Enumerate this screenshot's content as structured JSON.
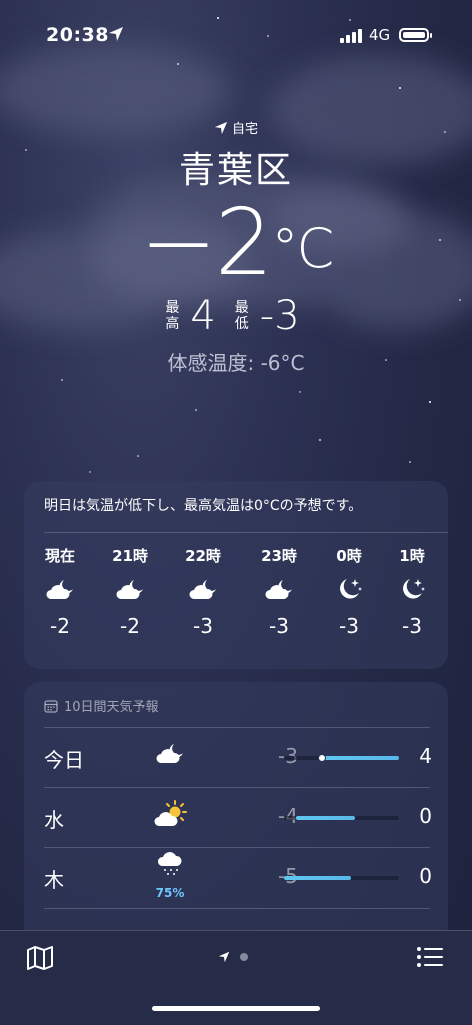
{
  "status": {
    "time": "20:38",
    "network": "4G"
  },
  "header": {
    "my_location_label": "自宅",
    "city": "青葉区",
    "temperature": "−2",
    "unit": "°C",
    "hi_label_1": "最",
    "hi_label_2": "高",
    "hi_value": "4",
    "lo_label_1": "最",
    "lo_label_2": "低",
    "lo_value": "-3",
    "feels_like": "体感温度: -6°C"
  },
  "hourly": {
    "summary": "明日は気温が低下し、最高気温は0°Cの予想です。",
    "items": [
      {
        "label": "現在",
        "temp": "-2",
        "icon": "cloud-moon-icon"
      },
      {
        "label": "21時",
        "temp": "-2",
        "icon": "cloud-moon-icon"
      },
      {
        "label": "22時",
        "temp": "-3",
        "icon": "cloud-moon-icon"
      },
      {
        "label": "23時",
        "temp": "-3",
        "icon": "cloud-moon-icon"
      },
      {
        "label": "0時",
        "temp": "-3",
        "icon": "moon-stars-icon"
      },
      {
        "label": "1時",
        "temp": "-3",
        "icon": "moon-stars-icon"
      }
    ]
  },
  "daily": {
    "title": "10日間天気予報",
    "days": [
      {
        "day": "今日",
        "icon": "cloud-moon-icon",
        "low": "-3",
        "high": "4",
        "precip": "",
        "range_start": 0.3,
        "range_end": 1.0,
        "current": 0.33
      },
      {
        "day": "水",
        "icon": "partly-sunny-icon",
        "low": "-4",
        "high": "0",
        "precip": "",
        "range_start": 0.1,
        "range_end": 0.62
      },
      {
        "day": "木",
        "icon": "cloud-sleet-icon",
        "low": "-5",
        "high": "0",
        "precip": "75%",
        "range_start": 0.0,
        "range_end": 0.58
      }
    ]
  },
  "colors": {
    "accent_bar": "#5ec8f0",
    "precip_text": "#6ec6ff",
    "sun": "#f5c33b"
  }
}
